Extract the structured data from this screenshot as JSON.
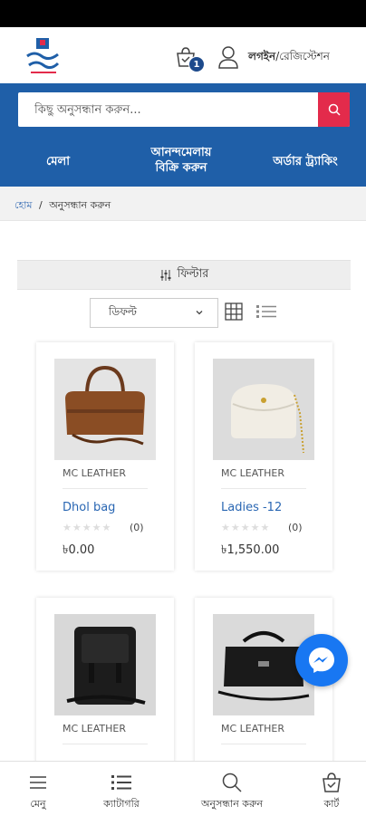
{
  "header": {
    "cart_count": "1",
    "login_label": "লগইন",
    "register_label": "/রেজিস্টেশন"
  },
  "search": {
    "placeholder": "কিছু অনুসন্ধান করুন..."
  },
  "nav": {
    "items": [
      {
        "label": "মেলা"
      },
      {
        "label_line1": "আনন্দমেলায়",
        "label_line2": "বিক্রি করুন"
      },
      {
        "label": "অর্ডার ট্র্যাকিং"
      }
    ]
  },
  "breadcrumb": {
    "home": "হোম",
    "separator": "/",
    "current": "অনুসন্ধান করুন"
  },
  "filter": {
    "label": "ফিল্টার"
  },
  "sort": {
    "selected": "ডিফল্ট"
  },
  "products": [
    {
      "brand": "MC LEATHER",
      "title": "Dhol bag",
      "rating_count": "(0)",
      "price": "৳0.00",
      "stars": "★★★★★"
    },
    {
      "brand": "MC LEATHER",
      "title": "Ladies -12",
      "rating_count": "(0)",
      "price": "৳1,550.00",
      "stars": "★★★★★"
    },
    {
      "brand": "MC LEATHER",
      "title": "",
      "rating_count": "",
      "price": "",
      "stars": ""
    },
    {
      "brand": "MC LEATHER",
      "title": "",
      "rating_count": "",
      "price": "",
      "stars": ""
    }
  ],
  "bottom_nav": {
    "menu": "মেনু",
    "category": "ক্যাটাগরি",
    "search": "অনুসন্ধান করুন",
    "cart": "কার্ট"
  },
  "colors": {
    "brand_blue": "#1f5fa8",
    "search_red": "#e32b4b",
    "messenger_blue": "#1877f2"
  }
}
